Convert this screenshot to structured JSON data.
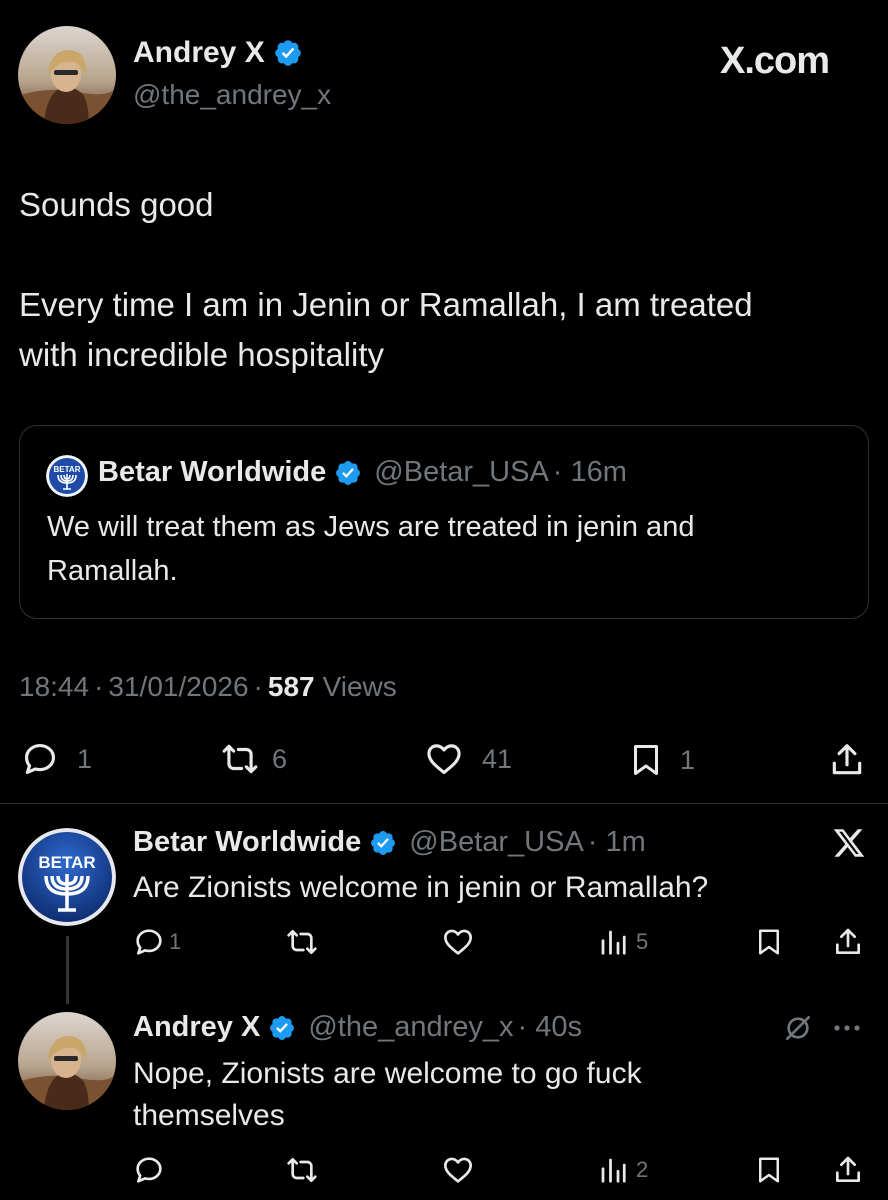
{
  "main_tweet": {
    "author_name": "Andrey X",
    "author_handle": "@the_andrey_x",
    "brand": "X.com",
    "text_line1": "Sounds good",
    "text_line2": "Every time I am in Jenin or Ramallah, I am treated",
    "text_line3": "with incredible hospitality",
    "quote": {
      "author_name": "Betar Worldwide",
      "author_handle": "@Betar_USA",
      "time": "· 16m",
      "text_line1": "We will treat them as Jews are treated in jenin  and",
      "text_line2": "Ramallah."
    },
    "meta": {
      "time": "18:44",
      "sep1": "·",
      "date": "31/01/2026",
      "sep2": "·",
      "views_count": "587",
      "views_label": "Views"
    },
    "actions": {
      "replies": "1",
      "reposts": "6",
      "likes": "41",
      "bookmarks": "1"
    }
  },
  "reply1": {
    "author_name": "Betar Worldwide",
    "author_handle": "@Betar_USA",
    "time": "· 1m",
    "avatar_text": "BETAR",
    "text": "Are Zionists welcome in jenin or Ramallah?",
    "actions": {
      "replies": "1",
      "views": "5"
    }
  },
  "reply2": {
    "author_name": "Andrey X",
    "author_handle": "@the_andrey_x",
    "time": "· 40s",
    "text_line1": "Nope, Zionists are welcome to go fuck",
    "text_line2": "themselves",
    "actions": {
      "views": "2"
    }
  },
  "colors": {
    "background": "#000000",
    "text": "#e7e9ea",
    "secondary": "#71767b",
    "verified": "#1d9bf0",
    "border": "#2f3336"
  },
  "icons": [
    "verified-badge-icon",
    "reply-icon",
    "repost-icon",
    "like-icon",
    "bookmark-icon",
    "share-icon",
    "views-icon",
    "close-x-icon",
    "mute-icon",
    "more-icon"
  ]
}
